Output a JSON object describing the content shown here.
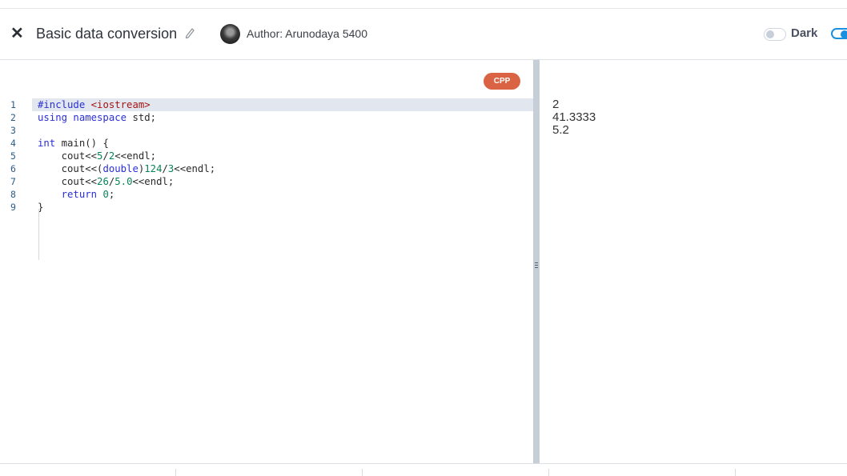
{
  "header": {
    "close_icon": "close-icon",
    "title": "Basic data conversion",
    "edit_icon": "pencil-icon",
    "author": "Author: Arunodaya 5400",
    "theme_label": "Dark"
  },
  "editor": {
    "language_badge": "CPP",
    "lines": [
      {
        "n": "1",
        "html": "<span class=\"kw\">#include</span> <span class=\"str\">&lt;iostream&gt;</span>"
      },
      {
        "n": "2",
        "html": "<span class=\"kw\">using namespace</span> std;"
      },
      {
        "n": "3",
        "html": ""
      },
      {
        "n": "4",
        "html": "<span class=\"kw\">int</span> main() {"
      },
      {
        "n": "5",
        "html": "    cout&lt;&lt;<span class=\"num\">5</span>/<span class=\"num\">2</span>&lt;&lt;endl;"
      },
      {
        "n": "6",
        "html": "    cout&lt;&lt;(<span class=\"kw\">double</span>)<span class=\"num\">124</span>/<span class=\"num\">3</span>&lt;&lt;endl;"
      },
      {
        "n": "7",
        "html": "    cout&lt;&lt;<span class=\"num\">26</span>/<span class=\"num\">5.0</span>&lt;&lt;endl;"
      },
      {
        "n": "8",
        "html": "    <span class=\"kw\">return</span> <span class=\"num\">0</span>;"
      },
      {
        "n": "9",
        "html": "}"
      }
    ]
  },
  "output": {
    "lines": [
      "2",
      "41.3333",
      "5.2"
    ]
  }
}
